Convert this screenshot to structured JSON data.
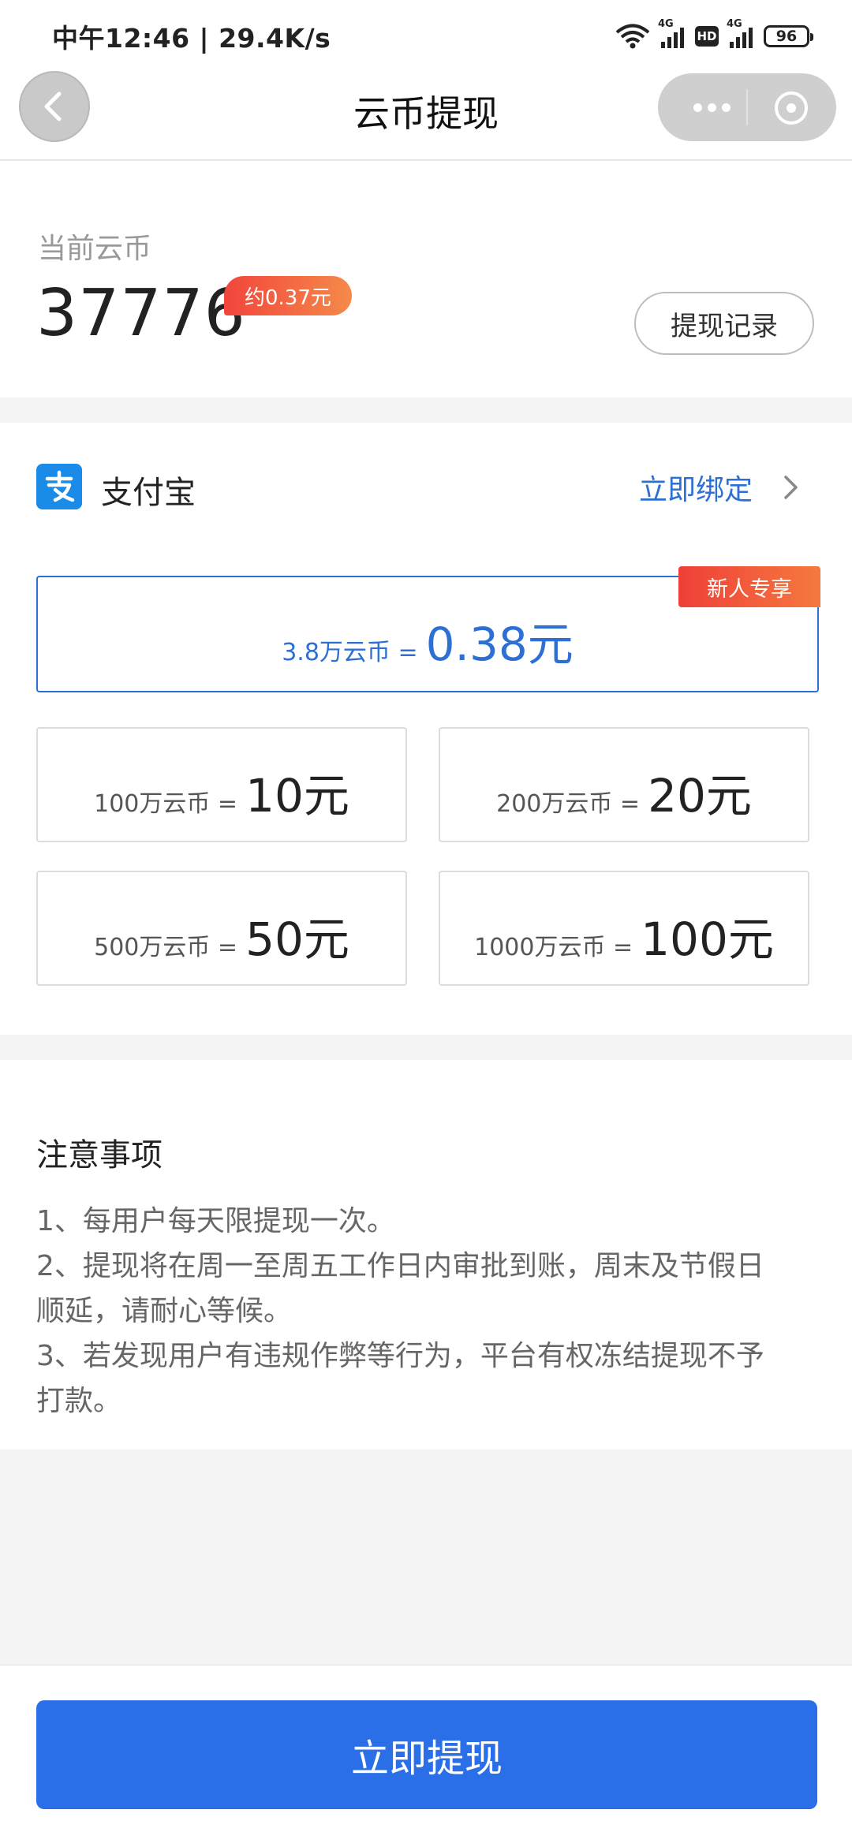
{
  "status_bar": {
    "time_speed": "中午12:46 | 29.4K/s",
    "net_label_1": "4G",
    "net_label_2": "4G",
    "hd_label": "HD",
    "battery": "96"
  },
  "nav": {
    "title": "云币提现"
  },
  "balance": {
    "label": "当前云币",
    "amount": "37776",
    "approx": "约0.37元",
    "record_button": "提现记录"
  },
  "payment": {
    "method": "支付宝",
    "bind_link": "立即绑定"
  },
  "options": {
    "new_user": {
      "tag": "新人专享",
      "coins": "3.8万云币 =",
      "amount": "0.38元"
    },
    "items": [
      {
        "coins": "100万云币 =",
        "amount": "10元"
      },
      {
        "coins": "200万云币 =",
        "amount": "20元"
      },
      {
        "coins": "500万云币 =",
        "amount": "50元"
      },
      {
        "coins": "1000万云币 =",
        "amount": "100元"
      }
    ]
  },
  "notes": {
    "title": "注意事项",
    "lines": [
      "1、每用户每天限提现一次。",
      "2、提现将在周一至周五工作日内审批到账，周末及节假日",
      "顺延，请耐心等候。",
      "3、若发现用户有违规作弊等行为，平台有权冻结提现不予",
      "打款。"
    ]
  },
  "submit_button": "立即提现",
  "colors": {
    "accent_blue": "#2a6fe8",
    "link_blue": "#2d6fd3",
    "badge_red": "#f2453c",
    "alipay_blue": "#1a8ce8"
  }
}
